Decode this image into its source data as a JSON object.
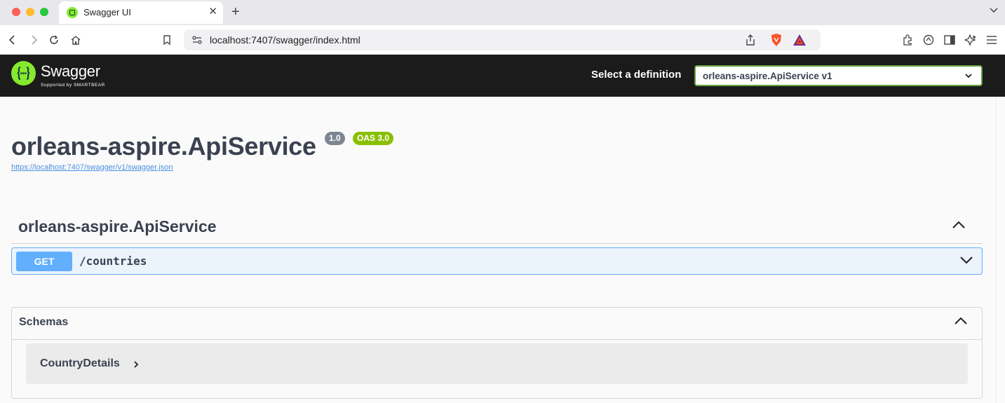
{
  "browser": {
    "tab_title": "Swagger UI",
    "url": "localhost:7407/swagger/index.html"
  },
  "swagger": {
    "logo_title": "Swagger",
    "logo_subtitle": "Supported by SMARTBEAR",
    "definition_label": "Select a definition",
    "definition_value": "orleans-aspire.ApiService v1"
  },
  "info": {
    "title": "orleans-aspire.ApiService",
    "version_badge": "1.0",
    "oas_badge": "OAS 3.0",
    "spec_url": "https://localhost:7407/swagger/v1/swagger.json"
  },
  "tag": {
    "name": "orleans-aspire.ApiService"
  },
  "operations": [
    {
      "method": "GET",
      "path": "/countries"
    }
  ],
  "schemas": {
    "title": "Schemas",
    "models": [
      {
        "name": "CountryDetails"
      }
    ]
  },
  "colors": {
    "get_method": "#61affe",
    "oas_badge": "#89bf04",
    "swagger_green": "#85ea2d",
    "topbar": "#1b1b1b"
  },
  "icons": [
    "back-icon",
    "forward-icon",
    "reload-icon",
    "home-icon",
    "bookmark-icon",
    "site-info-icon",
    "share-icon",
    "brave-shield-icon",
    "bat-rewards-icon",
    "extensions-icon",
    "leo-icon",
    "sidebar-icon",
    "ai-icon",
    "menu-icon",
    "chevron-down-icon",
    "chevron-up-icon",
    "chevron-right-icon",
    "close-icon",
    "plus-icon"
  ]
}
